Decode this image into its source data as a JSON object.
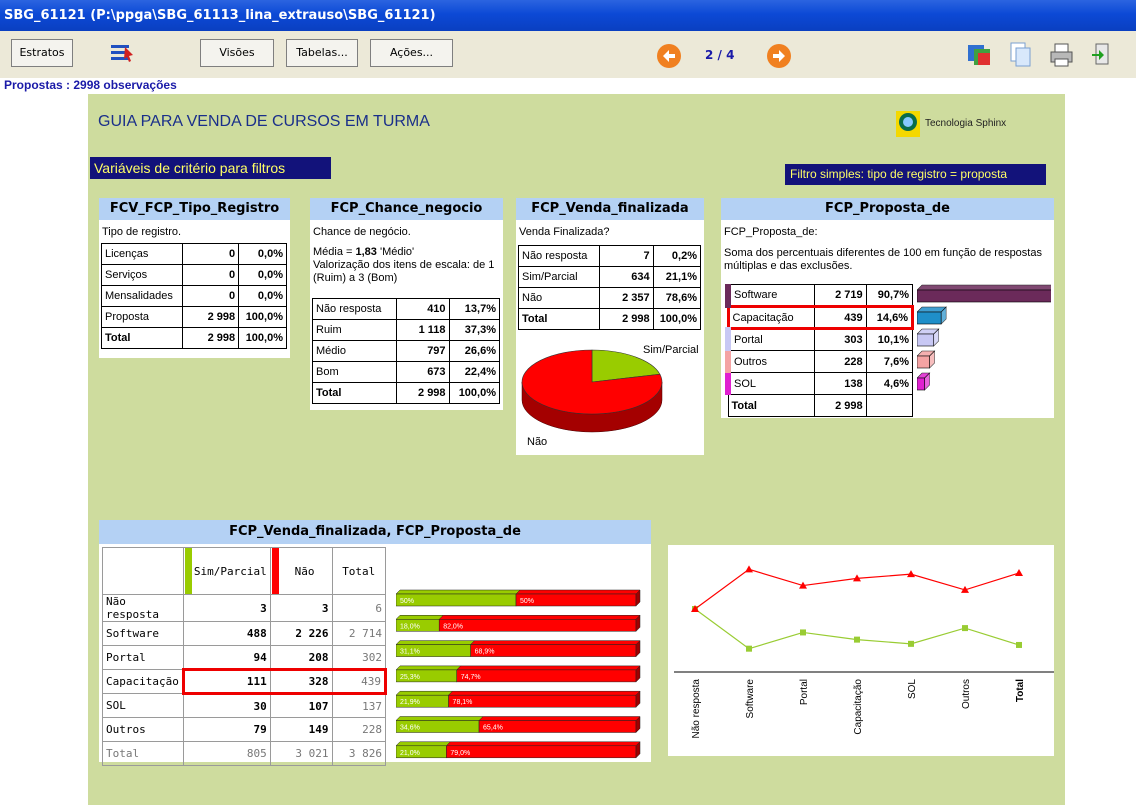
{
  "window": {
    "title": "SBG_61121 (P:\\ppga\\SBG_61113_lina_extrauso\\SBG_61121)"
  },
  "toolbar": {
    "estratos": "Estratos",
    "visoes": "Visões",
    "tabelas": "Tabelas...",
    "acoes": "Ações...",
    "page": "2 / 4"
  },
  "status": "Propostas : 2998 observações",
  "report": {
    "title": "GUIA PARA VENDA DE CURSOS EM TURMA",
    "brand": "Tecnologia Sphinx",
    "criteria": "Variáveis de critério para filtros",
    "filter": "Filtro simples: tipo de registro = proposta"
  },
  "panel1": {
    "head": "FCV_FCP_Tipo_Registro",
    "question": "Tipo de registro.",
    "rows": [
      [
        "Licenças",
        "0",
        "0,0%"
      ],
      [
        "Serviços",
        "0",
        "0,0%"
      ],
      [
        "Mensalidades",
        "0",
        "0,0%"
      ],
      [
        "Proposta",
        "2 998",
        "100,0%"
      ],
      [
        "Total",
        "2 998",
        "100,0%"
      ]
    ]
  },
  "panel2": {
    "head": "FCP_Chance_negocio",
    "question": "Chance de negócio.",
    "mean_prefix": "Média = ",
    "mean_value": "1,83",
    "mean_suffix": " 'Médio'",
    "scale_note": "Valorização dos itens de escala: de 1 (Ruim) a 3 (Bom)",
    "rows": [
      [
        "Não resposta",
        "410",
        "13,7%"
      ],
      [
        "Ruim",
        "1 118",
        "37,3%"
      ],
      [
        "Médio",
        "797",
        "26,6%"
      ],
      [
        "Bom",
        "673",
        "22,4%"
      ],
      [
        "Total",
        "2 998",
        "100,0%"
      ]
    ]
  },
  "panel3": {
    "head": "FCP_Venda_finalizada",
    "question": "Venda Finalizada?",
    "rows": [
      [
        "Não resposta",
        "7",
        "0,2%"
      ],
      [
        "Sim/Parcial",
        "634",
        "21,1%"
      ],
      [
        "Não",
        "2 357",
        "78,6%"
      ],
      [
        "Total",
        "2 998",
        "100,0%"
      ]
    ],
    "pie_label_sim": "Sim/Parcial",
    "pie_label_nao": "Não",
    "pie": [
      {
        "label": "Sim/Parcial",
        "pct": 21.1,
        "color": "#99cc00"
      },
      {
        "label": "Não",
        "pct": 78.9,
        "color": "#ff0000"
      }
    ]
  },
  "panel4": {
    "head": "FCP_Proposta_de",
    "question": "FCP_Proposta_de:",
    "note": "Soma dos percentuais diferentes de 100 em função de respostas múltiplas e das exclusões.",
    "rows": [
      [
        "Software",
        "2 719",
        "90,7%"
      ],
      [
        "Capacitação",
        "439",
        "14,6%"
      ],
      [
        "Portal",
        "303",
        "10,1%"
      ],
      [
        "Outros",
        "228",
        "7,6%"
      ],
      [
        "SOL",
        "138",
        "4,6%"
      ],
      [
        "Total",
        "2 998",
        ""
      ]
    ],
    "colors": [
      "#6b2a5a",
      "#1f8fc9",
      "#c8c8f4",
      "#f4a3a3",
      "#e020d0"
    ],
    "bar_pct": [
      90.7,
      14.6,
      10.1,
      7.6,
      4.6
    ]
  },
  "cross": {
    "head": "FCP_Venda_finalizada, FCP_Proposta_de",
    "col_sim": "Sim/Parcial",
    "col_nao": "Não",
    "col_total": "Total",
    "rows": [
      [
        "Não resposta",
        "3",
        "3",
        "6"
      ],
      [
        "Software",
        "488",
        "2 226",
        "2 714"
      ],
      [
        "Portal",
        "94",
        "208",
        "302"
      ],
      [
        "Capacitação",
        "111",
        "328",
        "439"
      ],
      [
        "SOL",
        "30",
        "107",
        "137"
      ],
      [
        "Outros",
        "79",
        "149",
        "228"
      ],
      [
        "Total",
        "805",
        "3 021",
        "3 826"
      ]
    ],
    "bars": [
      {
        "sim": 50.0,
        "nao": 50.0,
        "sim_label": "50%",
        "nao_label": "50%"
      },
      {
        "sim": 18.0,
        "nao": 82.0,
        "sim_label": "18,0%",
        "nao_label": "82,0%"
      },
      {
        "sim": 31.1,
        "nao": 68.9,
        "sim_label": "31,1%",
        "nao_label": "68,9%"
      },
      {
        "sim": 25.3,
        "nao": 74.7,
        "sim_label": "25,3%",
        "nao_label": "74,7%"
      },
      {
        "sim": 21.9,
        "nao": 78.1,
        "sim_label": "21,9%",
        "nao_label": "78,1%"
      },
      {
        "sim": 34.6,
        "nao": 65.4,
        "sim_label": "34,6%",
        "nao_label": "65,4%"
      },
      {
        "sim": 21.0,
        "nao": 79.0,
        "sim_label": "21,0%",
        "nao_label": "79,0%"
      }
    ]
  },
  "chart_data": {
    "type": "line",
    "categories": [
      "Não resposta",
      "Software",
      "Portal",
      "Capacitação",
      "SOL",
      "Outros",
      "Total"
    ],
    "series": [
      {
        "name": "Sim/Parcial",
        "color": "#99cc33",
        "values": [
          50.0,
          18.0,
          31.1,
          25.3,
          21.9,
          34.6,
          21.0
        ]
      },
      {
        "name": "Não",
        "color": "#ff0000",
        "values": [
          50.0,
          82.0,
          68.9,
          74.7,
          78.1,
          65.4,
          79.0
        ]
      }
    ],
    "ylim": [
      0,
      100
    ],
    "grid": false
  }
}
